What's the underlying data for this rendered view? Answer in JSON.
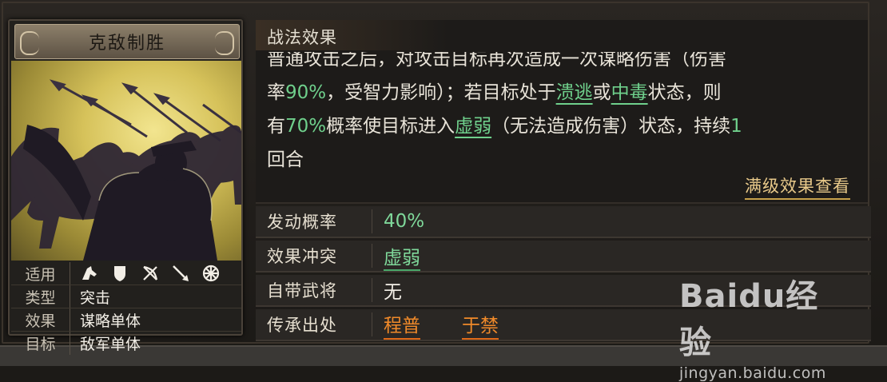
{
  "card": {
    "title": "克敌制胜",
    "rows": [
      {
        "label": "适用",
        "icons": [
          "cavalry-icon",
          "shield-icon",
          "bow-icon",
          "spear-icon",
          "wheel-icon"
        ]
      },
      {
        "label": "类型",
        "value": "突击"
      },
      {
        "label": "效果",
        "value": "谋略单体"
      },
      {
        "label": "目标",
        "value": "敌军单体"
      }
    ]
  },
  "effect": {
    "header": "战法效果",
    "line0": "普通攻击之后，对攻击目标再次造成一次谋略伤害（伤害",
    "line1_a": "率",
    "line1_pct": "90%",
    "line1_b": "，受智力影响）；若目标处于",
    "status1": "溃逃",
    "line1_or": "或",
    "status2": "中毒",
    "line1_c": "状态，则",
    "line2_a": "有",
    "line2_pct": "70%",
    "line2_b": "概率使目标进入",
    "status3": "虚弱",
    "line2_c": "（无法造成伤害）状态，持续",
    "line2_turns": "1",
    "line3": "回合",
    "view_full": "满级效果查看"
  },
  "attrs": {
    "trigger_label": "发动概率",
    "trigger_value": "40%",
    "conflict_label": "效果冲突",
    "conflict_value": "虚弱",
    "own_general_label": "自带武将",
    "own_general_value": "无",
    "inherit_label": "传承出处",
    "inherit_values": [
      "程普",
      "于禁"
    ]
  },
  "watermark": {
    "logo": "Baidu经验",
    "url": "jingyan.baidu.com"
  },
  "colors": {
    "green": "#6fd08c",
    "orange": "#f08a2a",
    "gold": "#e8c98a"
  }
}
